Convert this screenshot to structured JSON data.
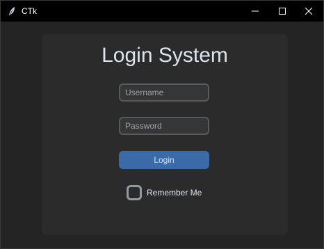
{
  "window": {
    "title": "CTk",
    "icon": "feather-icon",
    "controls": {
      "minimize_icon": "minimize-icon",
      "maximize_icon": "maximize-icon",
      "close_icon": "close-icon"
    }
  },
  "login": {
    "heading": "Login System",
    "username_placeholder": "Username",
    "username_value": "",
    "password_placeholder": "Password",
    "password_value": "",
    "login_button_label": "Login",
    "remember_me_label": "Remember Me",
    "remember_me_checked": false
  },
  "colors": {
    "window_bg": "#242424",
    "frame_bg": "#2b2b2b",
    "titlebar_bg": "#000000",
    "entry_bg": "#343638",
    "entry_border": "#565b5e",
    "button_bg": "#3a6aa8",
    "text": "#dce4ee",
    "placeholder_text": "#9ea3a8",
    "checkbox_border": "#949a9f"
  }
}
